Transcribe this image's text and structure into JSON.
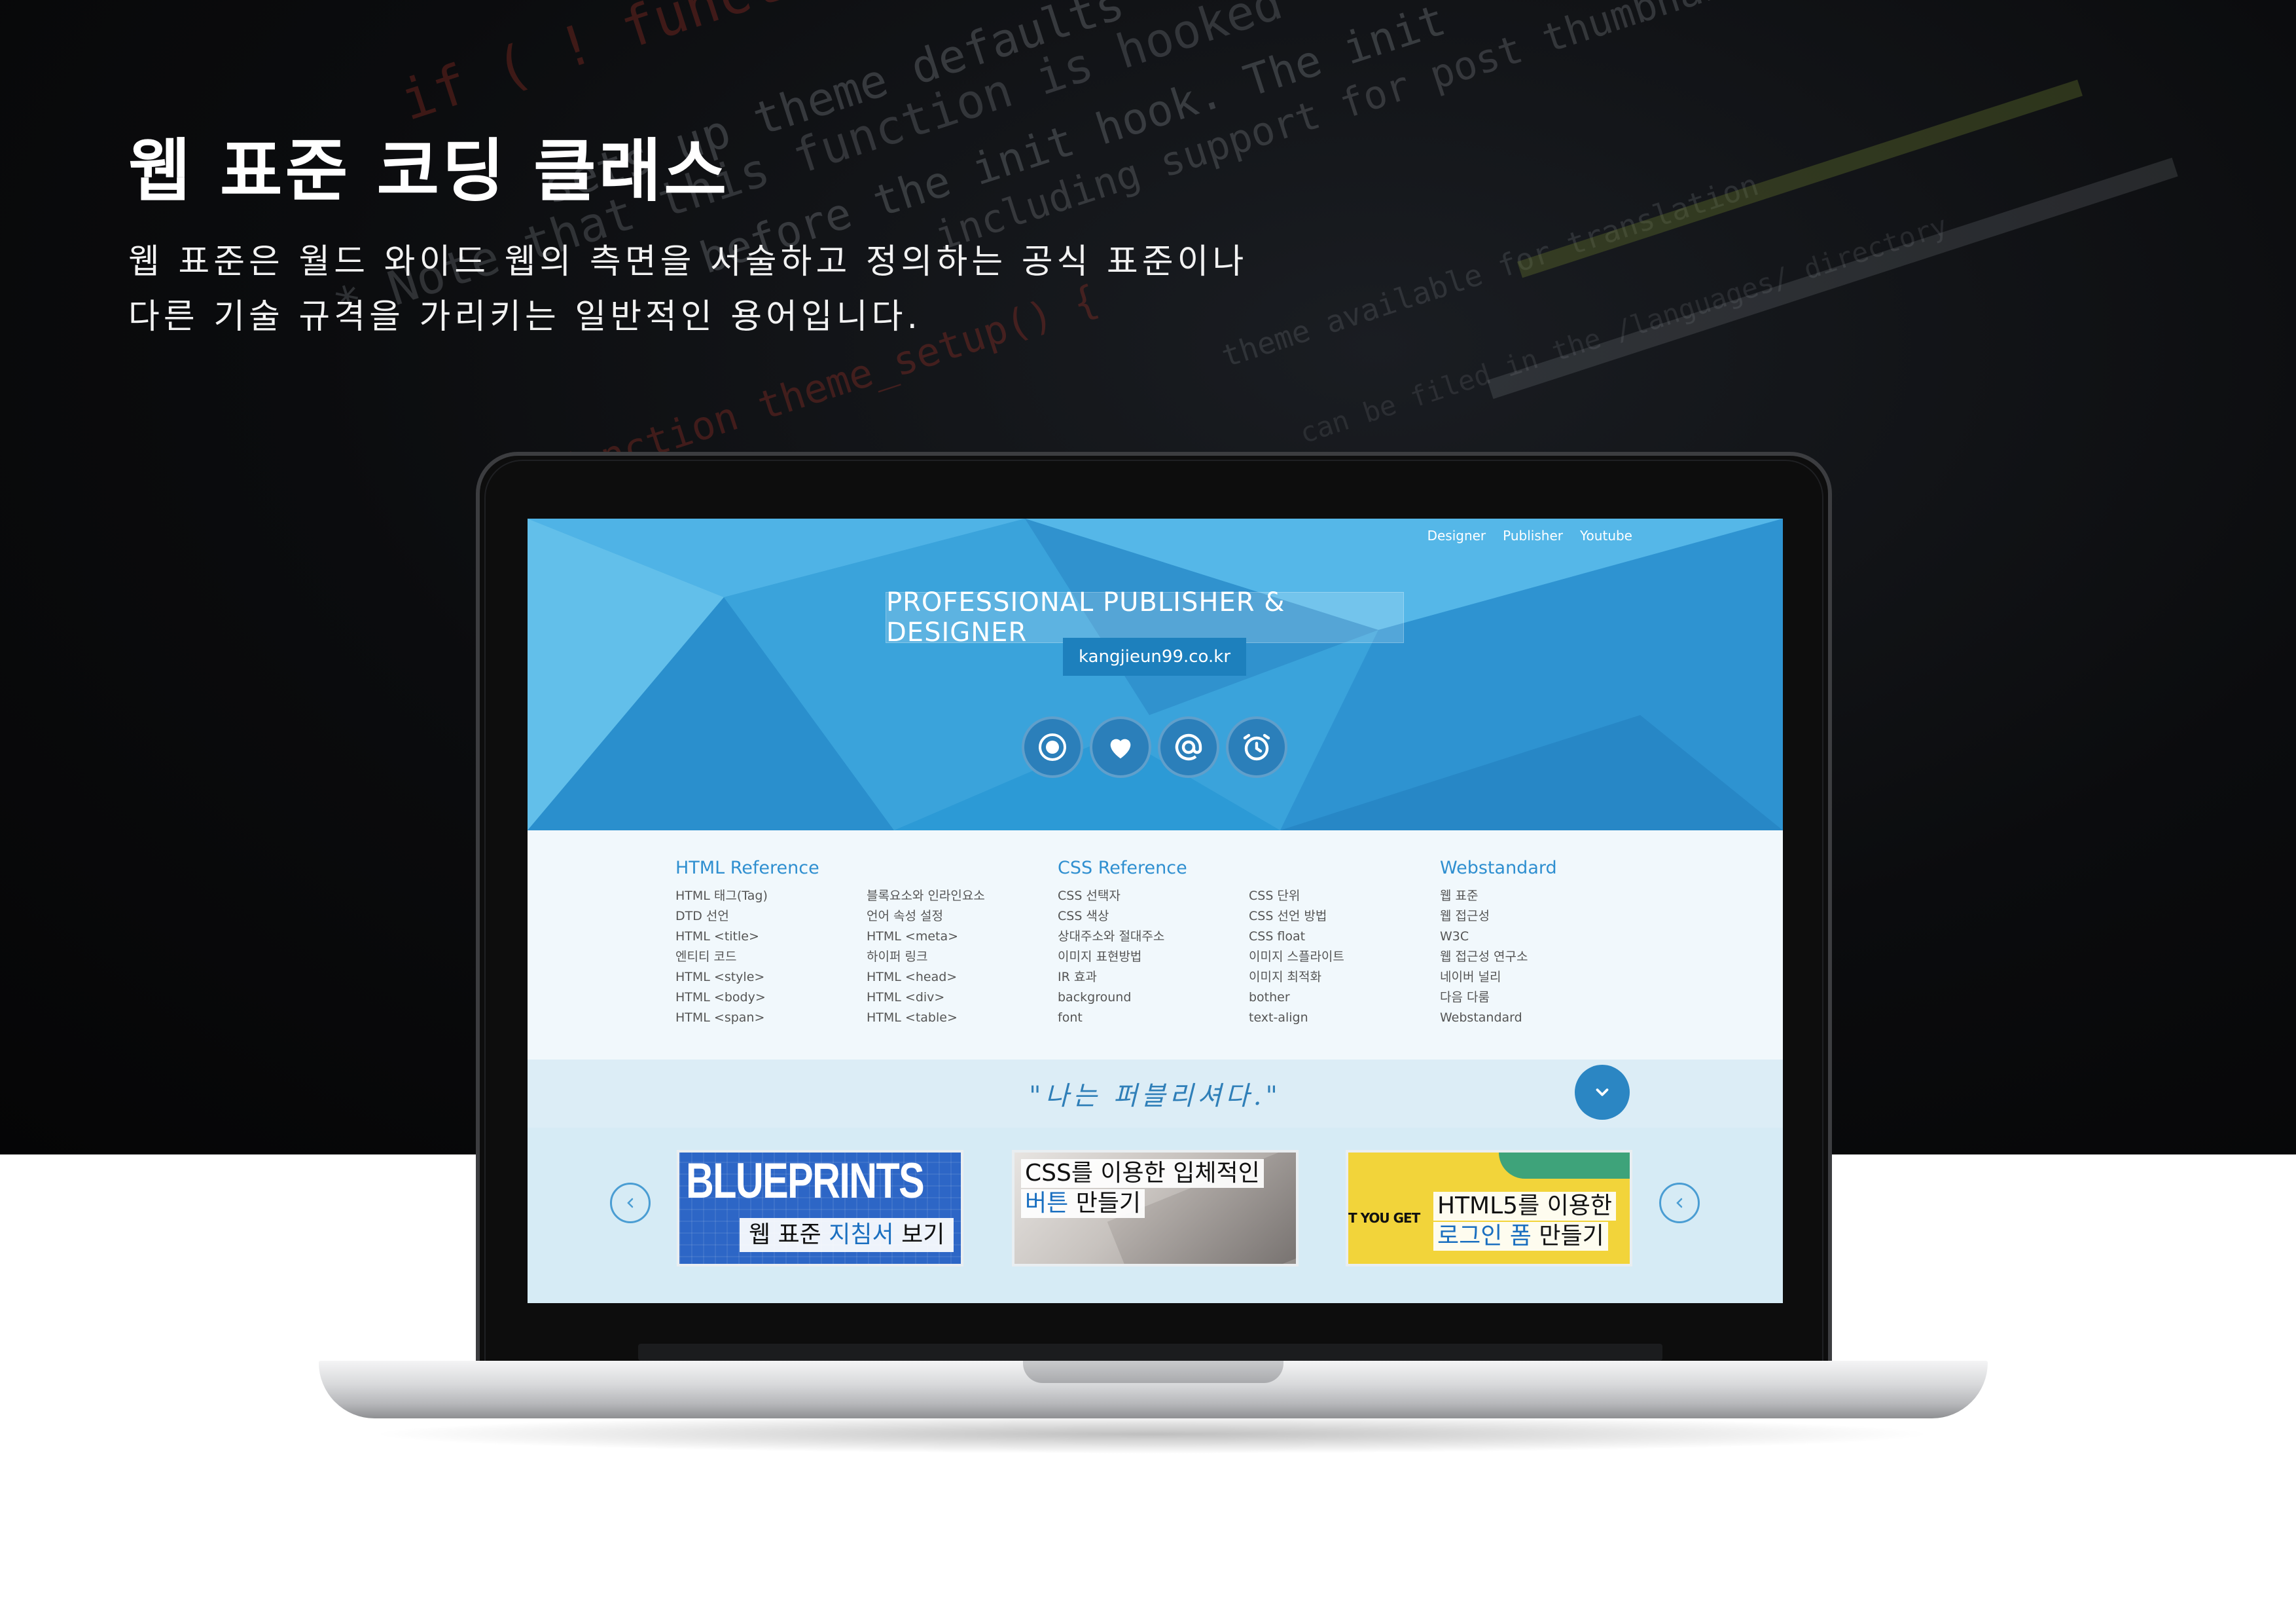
{
  "hero": {
    "title": "웹 표준 코딩 클래스",
    "desc_line1": "웹 표준은 월드 와이드 웹의 측면을 서술하고 정의하는 공식 표준이나",
    "desc_line2": "다른 기술 규격을 가리키는 일반적인 용어입니다."
  },
  "background_code": [
    "if ( ! function_exists",
    "sets up theme defaults",
    "* Note that this function is hooked",
    "before the init hook. The init",
    "including support for post thumbnails",
    "function  theme_setup() {",
    "theme available for translation",
    "can be filed in the /languages/ directory"
  ],
  "site": {
    "topnav": [
      "Designer",
      "Publisher",
      "Youtube"
    ],
    "headline": "PROFESSIONAL PUBLISHER & DESIGNER",
    "domain": "kangjieun99.co.kr",
    "icons": [
      "record-icon",
      "heart-icon",
      "at-icon",
      "alarm-clock-icon"
    ],
    "columns": [
      {
        "title": "HTML Reference",
        "items": [
          "HTML 태그(Tag)",
          "DTD 선언",
          "HTML <title>",
          "엔티티 코드",
          "HTML <style>",
          "HTML <body>",
          "HTML <span>"
        ]
      },
      {
        "title": "",
        "items": [
          "블록요소와 인라인요소",
          "언어 속성 설정",
          "HTML <meta>",
          "하이퍼 링크",
          "HTML <head>",
          "HTML <div>",
          "HTML <table>"
        ]
      },
      {
        "title": "CSS Reference",
        "items": [
          "CSS 선택자",
          "CSS 색상",
          "상대주소와 절대주소",
          "이미지 표현방법",
          "IR 효과",
          "background",
          "font"
        ]
      },
      {
        "title": "",
        "items": [
          "CSS 단위",
          "CSS 선언 방법",
          "CSS float",
          "이미지 스플라이트",
          "이미지 최적화",
          "bother",
          "text-align"
        ]
      },
      {
        "title": "Webstandard",
        "items": [
          "웹 표준",
          "웹 접근성",
          "W3C",
          "웹 접근성 연구소",
          "네이버 널리",
          "다음 다룸",
          "Webstandard"
        ]
      }
    ],
    "quote": "\"나는 퍼블리셔다.\"",
    "cards": [
      {
        "big": "BLUEPRINTS",
        "label_pre": "웹 표준 ",
        "label_hl": "지침서",
        "label_post": " 보기"
      },
      {
        "line1": "CSS를 이용한 입체적인",
        "line2_hl": "버튼",
        "line2_post": " 만들기"
      },
      {
        "side": "T YOU GET",
        "line1": "HTML5를 이용한",
        "line2_hl": "로그인 폼",
        "line2_post": " 만들기"
      }
    ]
  },
  "colors": {
    "accent": "#2b86c3",
    "header": "#3aa3db",
    "hero_bg": "#0b0c0e"
  }
}
